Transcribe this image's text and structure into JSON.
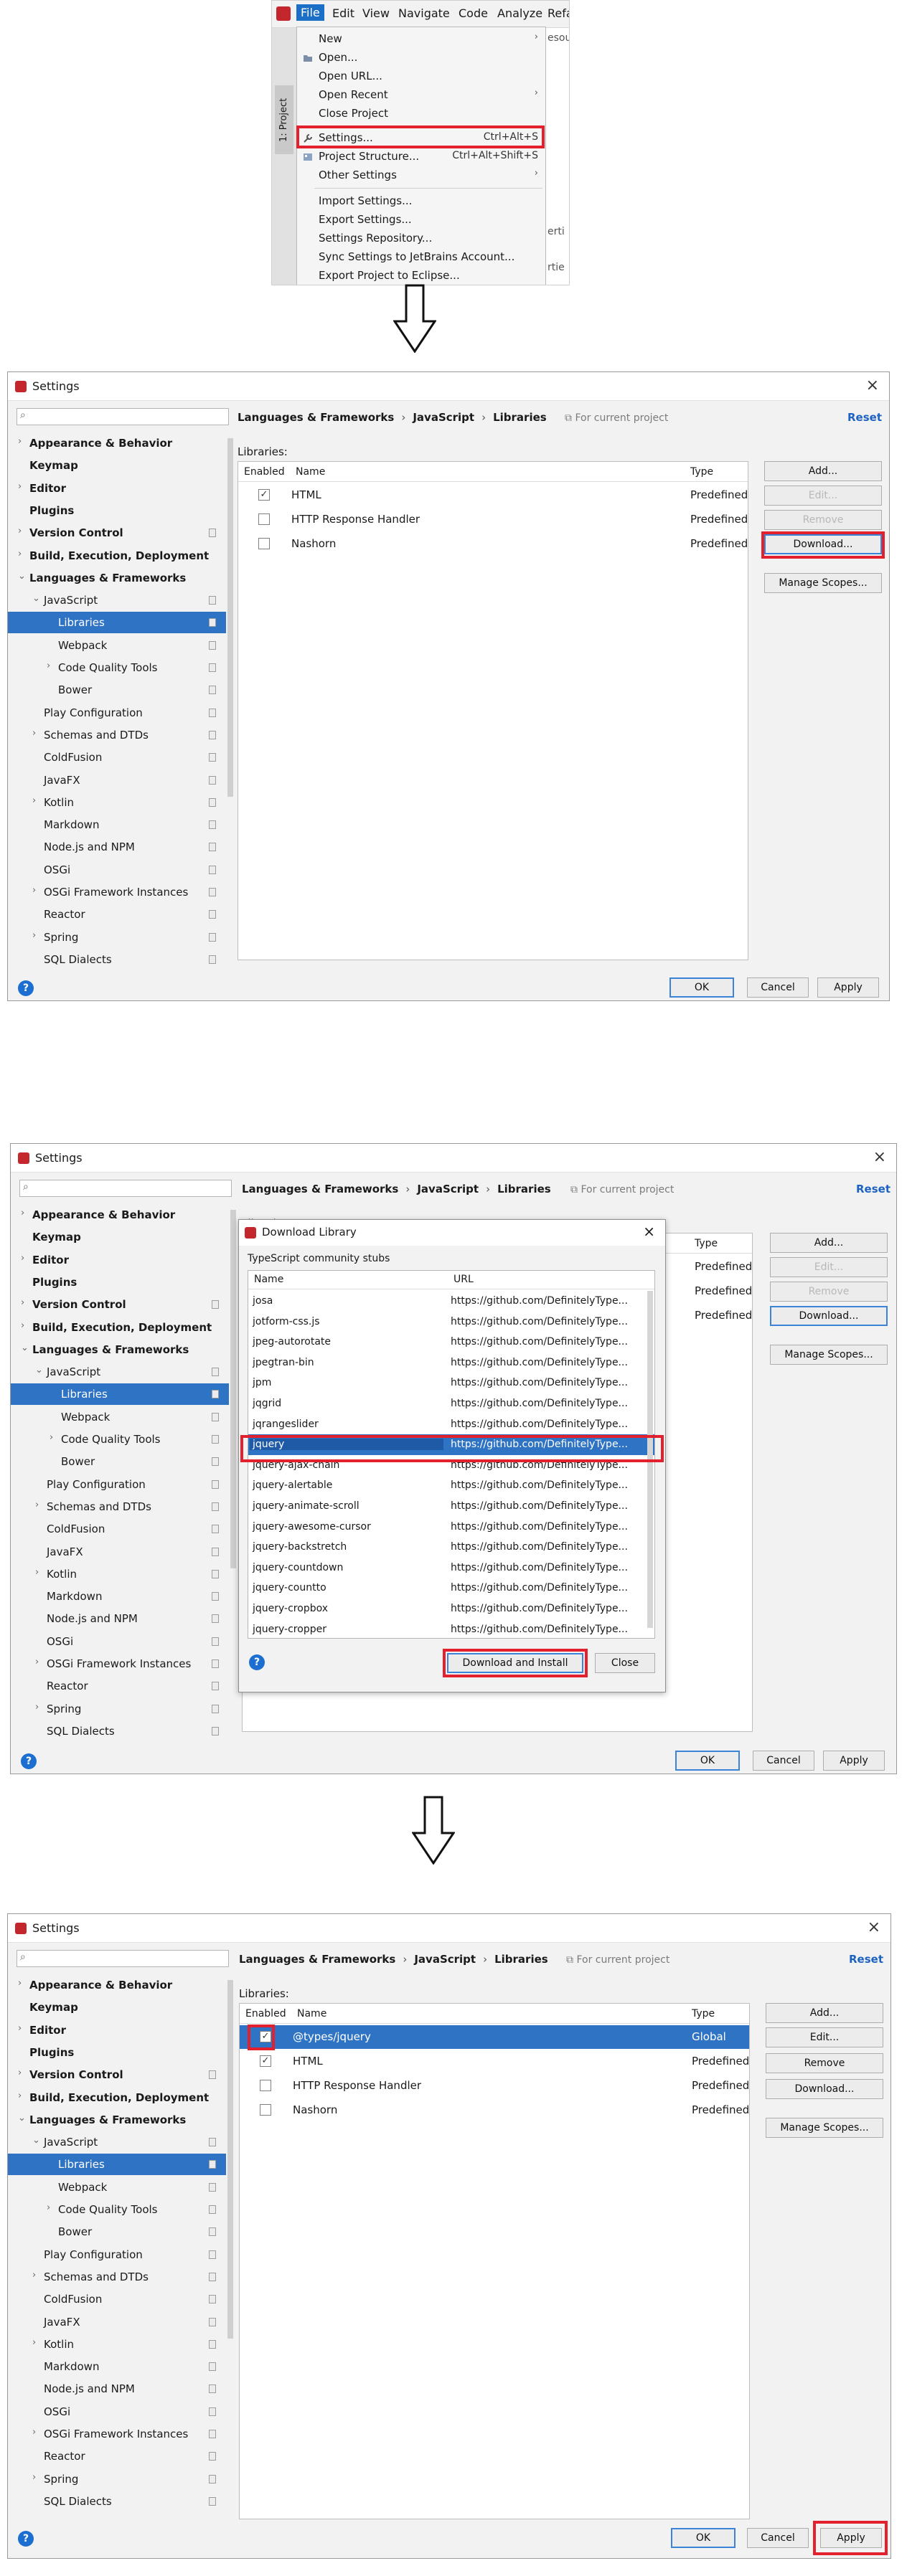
{
  "menu": {
    "bar": [
      "File",
      "Edit",
      "View",
      "Navigate",
      "Code",
      "Analyze",
      "Refa"
    ],
    "side_tab": "1: Project",
    "items": [
      {
        "label": "New",
        "shortcut": "",
        "arrow": "›"
      },
      {
        "label": "Open...",
        "shortcut": "",
        "arrow": ""
      },
      {
        "label": "Open URL...",
        "shortcut": "",
        "arrow": ""
      },
      {
        "label": "Open Recent",
        "shortcut": "",
        "arrow": "›"
      },
      {
        "label": "Close Project",
        "shortcut": "",
        "arrow": ""
      },
      {
        "label": "Settings...",
        "shortcut": "Ctrl+Alt+S",
        "arrow": ""
      },
      {
        "label": "Project Structure...",
        "shortcut": "Ctrl+Alt+Shift+S",
        "arrow": ""
      },
      {
        "label": "Other Settings",
        "shortcut": "",
        "arrow": "›"
      },
      {
        "label": "Import Settings...",
        "shortcut": "",
        "arrow": ""
      },
      {
        "label": "Export Settings...",
        "shortcut": "",
        "arrow": ""
      },
      {
        "label": "Settings Repository...",
        "shortcut": "",
        "arrow": ""
      },
      {
        "label": "Sync Settings to JetBrains Account...",
        "shortcut": "",
        "arrow": ""
      },
      {
        "label": "Export Project to Eclipse...",
        "shortcut": "",
        "arrow": ""
      }
    ],
    "right_fragments": [
      "esou",
      "erti",
      "rtie"
    ]
  },
  "dialog": {
    "title": "Settings",
    "close": "×",
    "breadcrumb": [
      "Languages & Frameworks",
      "JavaScript",
      "Libraries"
    ],
    "for_current_project": "For current project",
    "reset": "Reset",
    "libraries_label": "Libraries:",
    "columns": {
      "enabled": "Enabled",
      "name": "Name",
      "type": "Type"
    },
    "buttons": {
      "add": "Add...",
      "edit": "Edit...",
      "remove": "Remove",
      "download": "Download...",
      "manage_scopes": "Manage Scopes...",
      "ok": "OK",
      "cancel": "Cancel",
      "apply": "Apply"
    },
    "help": "?",
    "tree": [
      {
        "label": "Appearance & Behavior",
        "bold": true,
        "exp": "›",
        "level": 0
      },
      {
        "label": "Keymap",
        "bold": true,
        "exp": "",
        "level": 0
      },
      {
        "label": "Editor",
        "bold": true,
        "exp": "›",
        "level": 0
      },
      {
        "label": "Plugins",
        "bold": true,
        "exp": "",
        "level": 0
      },
      {
        "label": "Version Control",
        "bold": true,
        "exp": "›",
        "level": 0
      },
      {
        "label": "Build, Execution, Deployment",
        "bold": true,
        "exp": "›",
        "level": 0
      },
      {
        "label": "Languages & Frameworks",
        "bold": true,
        "exp": "⌄",
        "level": 0
      },
      {
        "label": "JavaScript",
        "bold": false,
        "exp": "⌄",
        "level": 1
      },
      {
        "label": "Libraries",
        "bold": false,
        "exp": "",
        "level": 2,
        "selected": true
      },
      {
        "label": "Webpack",
        "bold": false,
        "exp": "",
        "level": 2
      },
      {
        "label": "Code Quality Tools",
        "bold": false,
        "exp": "›",
        "level": 2
      },
      {
        "label": "Bower",
        "bold": false,
        "exp": "",
        "level": 2
      },
      {
        "label": "Play Configuration",
        "bold": false,
        "exp": "",
        "level": 1
      },
      {
        "label": "Schemas and DTDs",
        "bold": false,
        "exp": "›",
        "level": 1
      },
      {
        "label": "ColdFusion",
        "bold": false,
        "exp": "",
        "level": 1
      },
      {
        "label": "JavaFX",
        "bold": false,
        "exp": "",
        "level": 1
      },
      {
        "label": "Kotlin",
        "bold": false,
        "exp": "›",
        "level": 1
      },
      {
        "label": "Markdown",
        "bold": false,
        "exp": "",
        "level": 1
      },
      {
        "label": "Node.js and NPM",
        "bold": false,
        "exp": "",
        "level": 1
      },
      {
        "label": "OSGi",
        "bold": false,
        "exp": "",
        "level": 1
      },
      {
        "label": "OSGi Framework Instances",
        "bold": false,
        "exp": "›",
        "level": 1
      },
      {
        "label": "Reactor",
        "bold": false,
        "exp": "",
        "level": 1
      },
      {
        "label": "Spring",
        "bold": false,
        "exp": "›",
        "level": 1
      },
      {
        "label": "SQL Dialects",
        "bold": false,
        "exp": "",
        "level": 1
      }
    ],
    "libraries_initial": [
      {
        "name": "HTML",
        "type": "Predefined",
        "checked": true
      },
      {
        "name": "HTTP Response Handler",
        "type": "Predefined",
        "checked": false
      },
      {
        "name": "Nashorn",
        "type": "Predefined",
        "checked": false
      }
    ],
    "libraries_final": [
      {
        "name": "@types/jquery",
        "type": "Global",
        "checked": true
      },
      {
        "name": "HTML",
        "type": "Predefined",
        "checked": true
      },
      {
        "name": "HTTP Response Handler",
        "type": "Predefined",
        "checked": false
      },
      {
        "name": "Nashorn",
        "type": "Predefined",
        "checked": false
      }
    ]
  },
  "download_library": {
    "title": "Download Library",
    "subtitle": "TypeScript community stubs",
    "col_name": "Name",
    "col_url": "URL",
    "rows": [
      {
        "name": "josa",
        "url": "https://github.com/DefinitelyType..."
      },
      {
        "name": "jotform-css.js",
        "url": "https://github.com/DefinitelyType..."
      },
      {
        "name": "jpeg-autorotate",
        "url": "https://github.com/DefinitelyType..."
      },
      {
        "name": "jpegtran-bin",
        "url": "https://github.com/DefinitelyType..."
      },
      {
        "name": "jpm",
        "url": "https://github.com/DefinitelyType..."
      },
      {
        "name": "jqgrid",
        "url": "https://github.com/DefinitelyType..."
      },
      {
        "name": "jqrangeslider",
        "url": "https://github.com/DefinitelyType..."
      },
      {
        "name": "jquery",
        "url": "https://github.com/DefinitelyType...",
        "selected": true
      },
      {
        "name": "jquery-ajax-chain",
        "url": "https://github.com/DefinitelyType..."
      },
      {
        "name": "jquery-alertable",
        "url": "https://github.com/DefinitelyType..."
      },
      {
        "name": "jquery-animate-scroll",
        "url": "https://github.com/DefinitelyType..."
      },
      {
        "name": "jquery-awesome-cursor",
        "url": "https://github.com/DefinitelyType..."
      },
      {
        "name": "jquery-backstretch",
        "url": "https://github.com/DefinitelyType..."
      },
      {
        "name": "jquery-countdown",
        "url": "https://github.com/DefinitelyType..."
      },
      {
        "name": "jquery-countto",
        "url": "https://github.com/DefinitelyType..."
      },
      {
        "name": "jquery-cropbox",
        "url": "https://github.com/DefinitelyType..."
      },
      {
        "name": "jquery-cropper",
        "url": "https://github.com/DefinitelyType..."
      }
    ],
    "download_install": "Download and Install",
    "close": "Close"
  },
  "colors": {
    "highlight": "#e3202e",
    "selection": "#2f73c4",
    "link": "#1e62c2"
  }
}
